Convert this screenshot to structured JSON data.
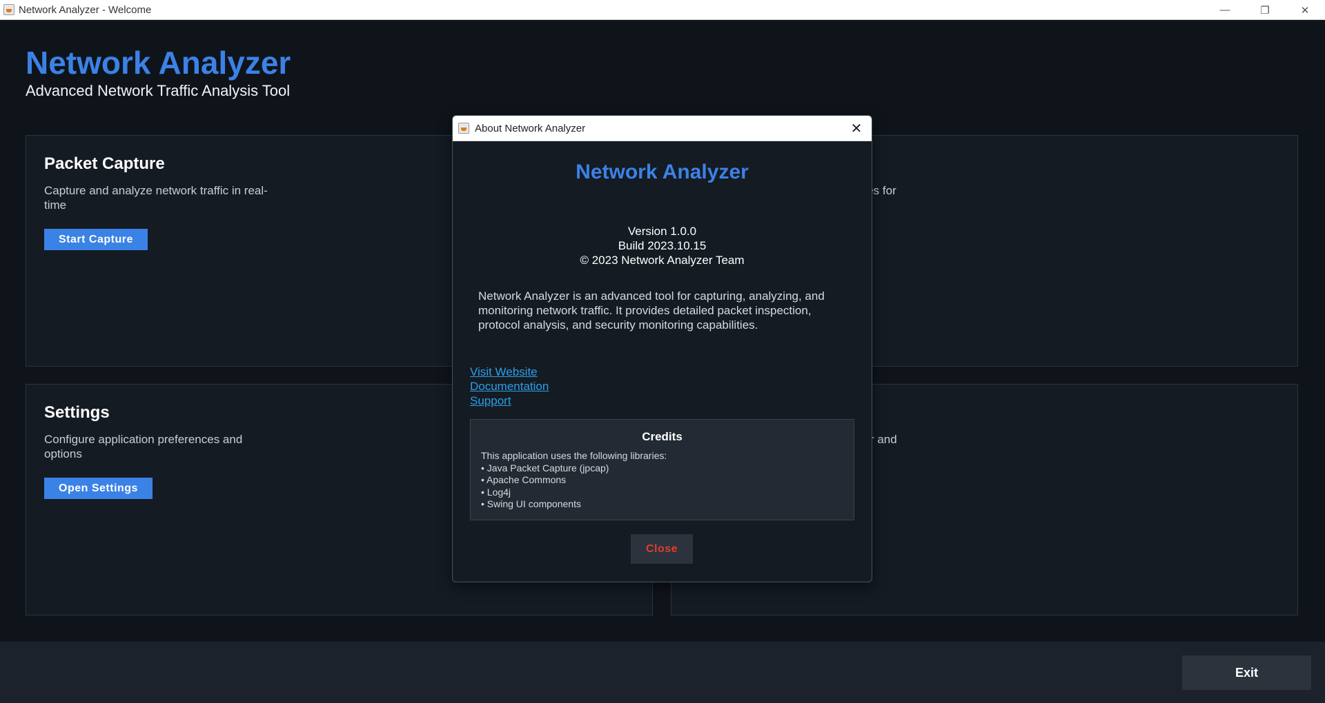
{
  "window": {
    "title": "Network Analyzer - Welcome",
    "minimize_glyph": "—",
    "maximize_glyph": "❐",
    "close_glyph": "✕"
  },
  "header": {
    "title": "Network Analyzer",
    "subtitle": "Advanced Network Traffic Analysis Tool"
  },
  "cards": [
    {
      "title": "Packet Capture",
      "description": "Capture and analyze network traffic in real-time",
      "button_label": "Start Capture"
    },
    {
      "description_fragment": "ules for"
    },
    {
      "title": "Settings",
      "description": "Configure application preferences and options",
      "button_label": "Open Settings"
    },
    {
      "description_fragment": "zer and"
    }
  ],
  "footer": {
    "exit_label": "Exit"
  },
  "dialog": {
    "title": "About Network Analyzer",
    "close_glyph": "✕",
    "app_name": "Network Analyzer",
    "version": "Version 1.0.0",
    "build": "Build 2023.10.15",
    "copyright": "© 2023 Network Analyzer Team",
    "description": "Network Analyzer is an advanced tool for capturing, analyzing, and monitoring network traffic. It provides detailed packet inspection, protocol analysis, and security monitoring capabilities.",
    "links": [
      "Visit Website",
      "Documentation",
      "Support"
    ],
    "credits": {
      "title": "Credits",
      "intro": "This application uses the following libraries:",
      "items": [
        "• Java Packet Capture (jpcap)",
        "• Apache Commons",
        "• Log4j",
        "• Swing UI components"
      ]
    },
    "close_button_label": "Close"
  },
  "colors": {
    "accent": "#3b82e6",
    "background": "#0f141b",
    "card": "#151b23",
    "link": "#2aa0e8",
    "danger": "#e23b2e"
  }
}
